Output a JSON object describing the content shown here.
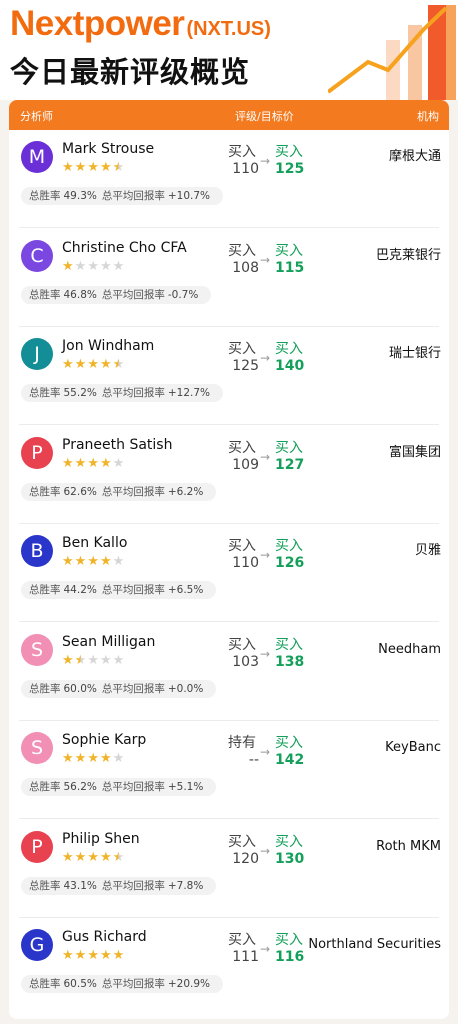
{
  "header": {
    "company": "Nextpower",
    "ticker": "(NXT.US)",
    "subtitle": "今日最新评级概览"
  },
  "table": {
    "col_analyst": "分析师",
    "col_rating": "评级/目标价",
    "col_institution": "机构",
    "win_rate_label": "总胜率",
    "avg_return_label": "总平均回报率"
  },
  "analysts": [
    {
      "initial": "M",
      "name": "Mark Strouse",
      "avatar_color": "#6a2fd6",
      "stars": 4.5,
      "rating_from": "买入",
      "rating_to": "买入",
      "price_from": "110",
      "price_to": "125",
      "institution": "摩根大通",
      "win_rate": "49.3%",
      "avg_return": "+10.7%",
      "return_sign": "pos"
    },
    {
      "initial": "C",
      "name": "Christine Cho CFA",
      "avatar_color": "#7a47e0",
      "stars": 1,
      "rating_from": "买入",
      "rating_to": "买入",
      "price_from": "108",
      "price_to": "115",
      "institution": "巴克莱银行",
      "win_rate": "46.8%",
      "avg_return": "-0.7%",
      "return_sign": "neg"
    },
    {
      "initial": "J",
      "name": "Jon Windham",
      "avatar_color": "#148e96",
      "stars": 4.5,
      "rating_from": "买入",
      "rating_to": "买入",
      "price_from": "125",
      "price_to": "140",
      "institution": "瑞士银行",
      "win_rate": "55.2%",
      "avg_return": "+12.7%",
      "return_sign": "pos"
    },
    {
      "initial": "P",
      "name": "Praneeth Satish",
      "avatar_color": "#e8414f",
      "stars": 4,
      "rating_from": "买入",
      "rating_to": "买入",
      "price_from": "109",
      "price_to": "127",
      "institution": "富国集团",
      "win_rate": "62.6%",
      "avg_return": "+6.2%",
      "return_sign": "pos"
    },
    {
      "initial": "B",
      "name": "Ben Kallo",
      "avatar_color": "#2a36c9",
      "stars": 4,
      "rating_from": "买入",
      "rating_to": "买入",
      "price_from": "110",
      "price_to": "126",
      "institution": "贝雅",
      "win_rate": "44.2%",
      "avg_return": "+6.5%",
      "return_sign": "pos"
    },
    {
      "initial": "S",
      "name": "Sean Milligan",
      "avatar_color": "#f28fb5",
      "stars": 1.5,
      "rating_from": "买入",
      "rating_to": "买入",
      "price_from": "103",
      "price_to": "138",
      "institution": "Needham",
      "win_rate": "60.0%",
      "avg_return": "+0.0%",
      "return_sign": "pos"
    },
    {
      "initial": "S",
      "name": "Sophie Karp",
      "avatar_color": "#f28fb5",
      "stars": 4,
      "rating_from": "持有",
      "rating_to": "买入",
      "price_from": "--",
      "price_to": "142",
      "institution": "KeyBanc",
      "win_rate": "56.2%",
      "avg_return": "+5.1%",
      "return_sign": "pos"
    },
    {
      "initial": "P",
      "name": "Philip Shen",
      "avatar_color": "#e8414f",
      "stars": 4.5,
      "rating_from": "买入",
      "rating_to": "买入",
      "price_from": "120",
      "price_to": "130",
      "institution": "Roth MKM",
      "win_rate": "43.1%",
      "avg_return": "+7.8%",
      "return_sign": "pos"
    },
    {
      "initial": "G",
      "name": "Gus Richard",
      "avatar_color": "#2a36c9",
      "stars": 5,
      "rating_from": "买入",
      "rating_to": "买入",
      "price_from": "111",
      "price_to": "116",
      "institution": "Northland Securities",
      "win_rate": "60.5%",
      "avg_return": "+20.9%",
      "return_sign": "pos"
    }
  ]
}
